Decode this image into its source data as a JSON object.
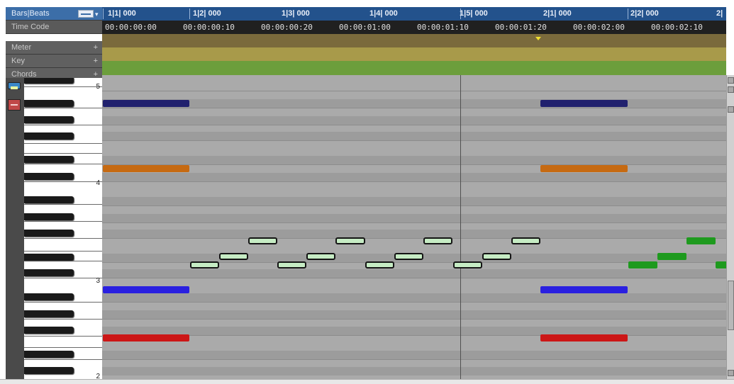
{
  "ruler_labels": {
    "bars_beats": "Bars|Beats",
    "time_code": "Time Code",
    "meter": "Meter",
    "key": "Key",
    "chords": "Chords",
    "add_symbol": "+"
  },
  "bars_ruler": [
    "1|1| 000",
    "1|2| 000",
    "1|3| 000",
    "1|4| 000",
    "1|5| 000",
    "2|1| 000",
    "2|2| 000",
    "2|"
  ],
  "time_code_ruler": [
    "00:00:00:00",
    "00:00:00:10",
    "00:00:00:20",
    "00:00:01:00",
    "00:00:01:10",
    "00:00:01:20",
    "00:00:02:00",
    "00:00:02:10"
  ],
  "octave_labels": [
    "5",
    "4",
    "3",
    "2"
  ],
  "tools": {
    "note_tool": "note-tool-icon",
    "erase_tool": "erase-tool-icon"
  },
  "colors": {
    "ruler_blue": "#23528c",
    "meter_lane": "#7a6a3c",
    "key_lane": "#a89a4a",
    "chords_lane": "#6c9e3c",
    "note_dark_blue": "#21216e",
    "note_orange": "#c66a12",
    "note_blue": "#2a20e0",
    "note_red": "#cc1616",
    "note_mint": "#c6ecc4",
    "note_green": "#1e9a1e"
  }
}
